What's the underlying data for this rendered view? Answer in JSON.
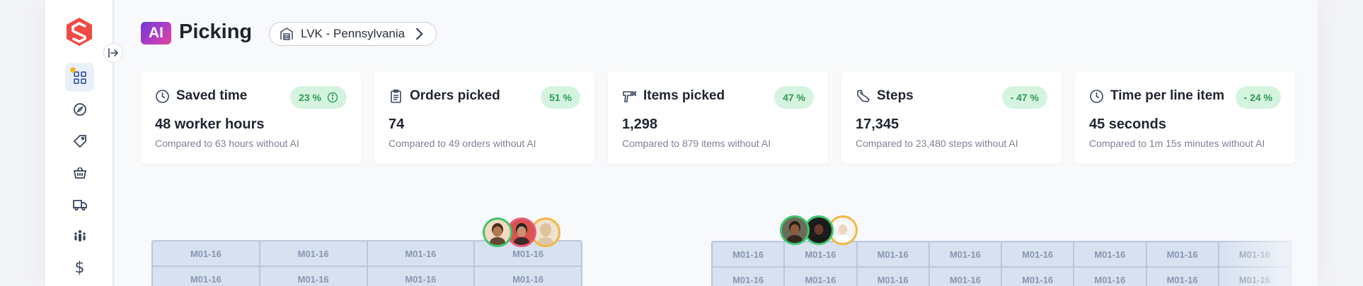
{
  "header": {
    "ai_badge": "AI",
    "title": "Picking",
    "location": "LVK - Pennsylvania"
  },
  "sidebar": {
    "items": [
      {
        "icon": "dashboard-icon",
        "active": true
      },
      {
        "icon": "compass-icon",
        "active": false
      },
      {
        "icon": "tag-icon",
        "active": false
      },
      {
        "icon": "basket-icon",
        "active": false
      },
      {
        "icon": "truck-icon",
        "active": false
      },
      {
        "icon": "team-icon",
        "active": false
      },
      {
        "icon": "dollar-icon",
        "label": "$",
        "active": false
      }
    ]
  },
  "metrics": [
    {
      "icon": "clock-icon",
      "title": "Saved time",
      "pill": "23 %",
      "pill_has_info": true,
      "value": "48 worker hours",
      "sub": "Compared to 63 hours without AI"
    },
    {
      "icon": "clipboard-icon",
      "title": "Orders picked",
      "pill": "51 %",
      "value": "74",
      "sub": "Compared to 49 orders without AI"
    },
    {
      "icon": "scanner-icon",
      "title": "Items picked",
      "pill": "47 %",
      "value": "1,298",
      "sub": "Compared to 879 items without AI"
    },
    {
      "icon": "shoe-icon",
      "title": "Steps",
      "pill": "- 47 %",
      "value": "17,345",
      "sub": "Compared to 23,480 steps without AI"
    },
    {
      "icon": "clock-icon",
      "title": "Time per line item",
      "pill": "- 24 %",
      "value": "45 seconds",
      "sub": "Compared to 1m 15s minutes without AI"
    }
  ],
  "floor_map": {
    "left_grid": {
      "rows": [
        [
          "M01-16",
          "M01-16",
          "M01-16",
          "M01-16"
        ],
        [
          "M01-16",
          "M01-16",
          "M01-16",
          "M01-16"
        ]
      ]
    },
    "right_grid": {
      "rows": [
        [
          "M01-16",
          "M01-16",
          "M01-16",
          "M01-16",
          "M01-16",
          "M01-16",
          "M01-16",
          "M01-16"
        ],
        [
          "M01-16",
          "M01-16",
          "M01-16",
          "M01-16",
          "M01-16",
          "M01-16",
          "M01-16",
          "M01-16"
        ]
      ]
    },
    "left_avatars": [
      {
        "ring": "#3ec46d",
        "skin": "#b07a52",
        "hair": "#4a2c1a",
        "bg": "#f2d9c0"
      },
      {
        "ring": "#e85a7a",
        "skin": "#c99270",
        "hair": "#222222",
        "bg": "#d9534f"
      },
      {
        "ring": "#f2b640",
        "skin": "#e1c39a",
        "hair": "#d8c3a0",
        "bg": "#efe3d0"
      }
    ],
    "right_avatars": [
      {
        "ring": "#3ec46d",
        "skin": "#8a5a3a",
        "hair": "#2a1c12",
        "bg": "#6b6b5a"
      },
      {
        "ring": "#3ec46d",
        "skin": "#6a3a2a",
        "hair": "#1a1a1a",
        "bg": "#1c1c1c"
      },
      {
        "ring": "#f2b640",
        "skin": "#f0d6c0",
        "hair": "#ffffff",
        "bg": "#f4f4f4"
      }
    ]
  },
  "colors": {
    "accent_green_bg": "#d5f4e0",
    "accent_green_text": "#2c9a54",
    "brand_red": "#ef4a43",
    "sidebar_icon": "#3b4660"
  }
}
